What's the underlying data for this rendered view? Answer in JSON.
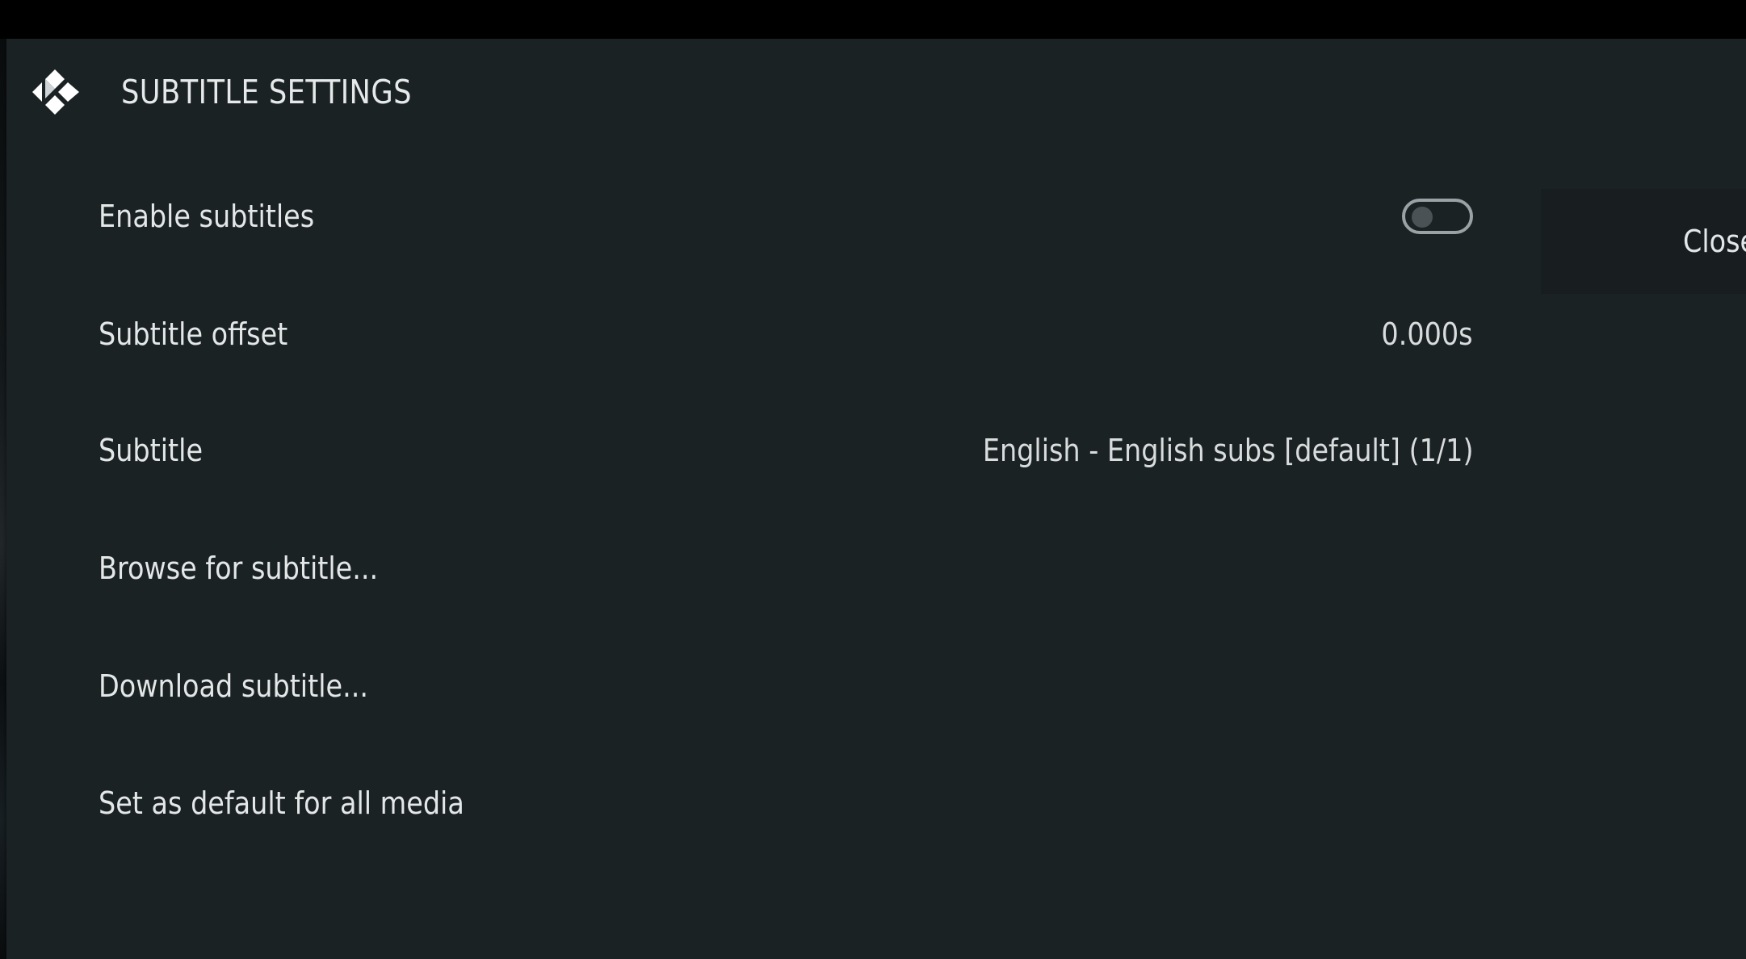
{
  "dialog": {
    "title": "SUBTITLE SETTINGS",
    "logo_icon": "kodi-logo-icon"
  },
  "settings": {
    "enable_subtitles": {
      "label": "Enable subtitles",
      "toggle_state": "off"
    },
    "subtitle_offset": {
      "label": "Subtitle offset",
      "value": "0.000s"
    },
    "subtitle": {
      "label": "Subtitle",
      "value": "English - English subs [default] (1/1)"
    },
    "browse": {
      "label": "Browse for subtitle..."
    },
    "download": {
      "label": "Download subtitle..."
    },
    "set_default": {
      "label": "Set as default for all media"
    }
  },
  "side_panel": {
    "close_label": "Close"
  },
  "colors": {
    "dialog_background": "#1b2224",
    "text": "#e3e7e8",
    "toggle_border": "#9aa2a5"
  }
}
